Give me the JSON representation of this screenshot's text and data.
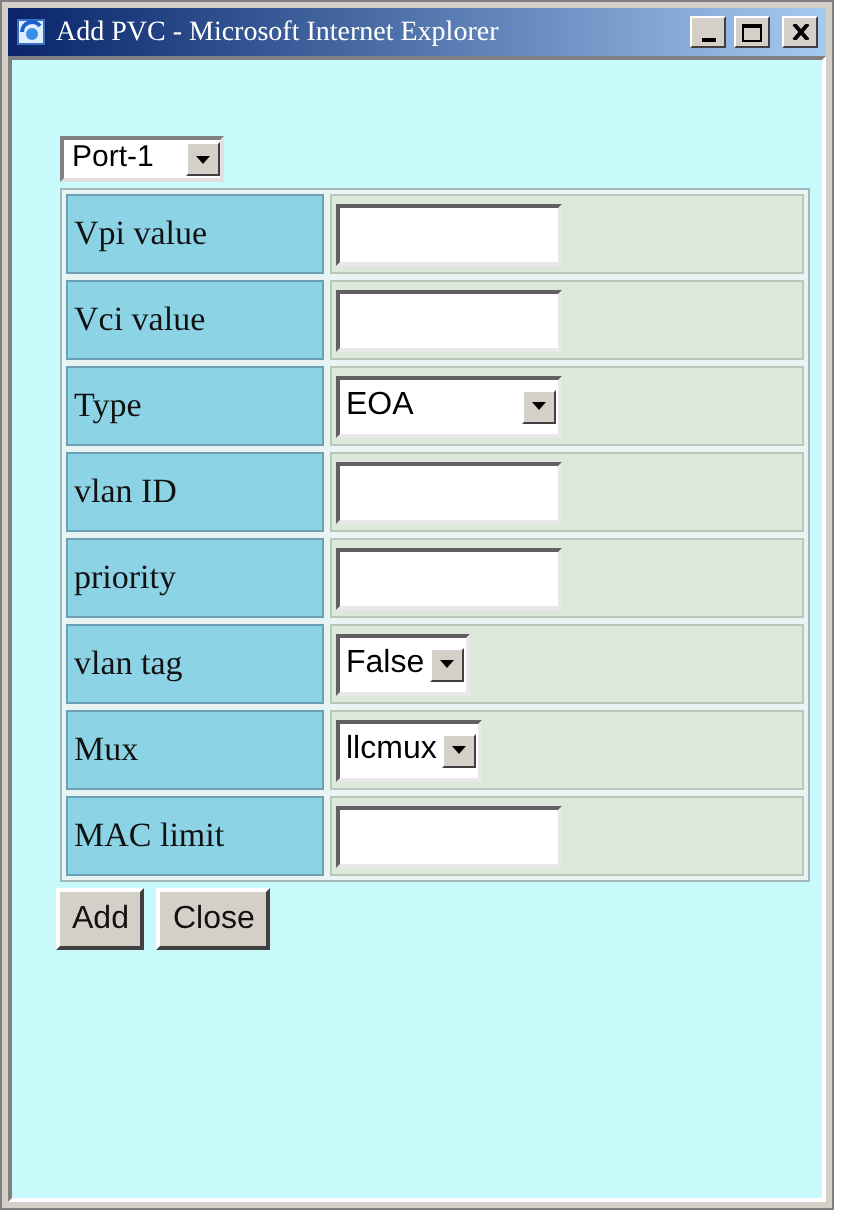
{
  "window": {
    "title": "Add PVC - Microsoft Internet Explorer"
  },
  "port_select": {
    "value": "Port-1"
  },
  "rows": [
    {
      "label": "Vpi value",
      "kind": "text"
    },
    {
      "label": "Vci value",
      "kind": "text"
    },
    {
      "label": "Type",
      "kind": "select",
      "value": "EOA"
    },
    {
      "label": "vlan ID",
      "kind": "text"
    },
    {
      "label": "priority",
      "kind": "text"
    },
    {
      "label": "vlan tag",
      "kind": "select",
      "value": "False"
    },
    {
      "label": "Mux",
      "kind": "select",
      "value": "llcmux"
    },
    {
      "label": "MAC limit",
      "kind": "text"
    }
  ],
  "buttons": [
    "Add",
    "Close"
  ]
}
